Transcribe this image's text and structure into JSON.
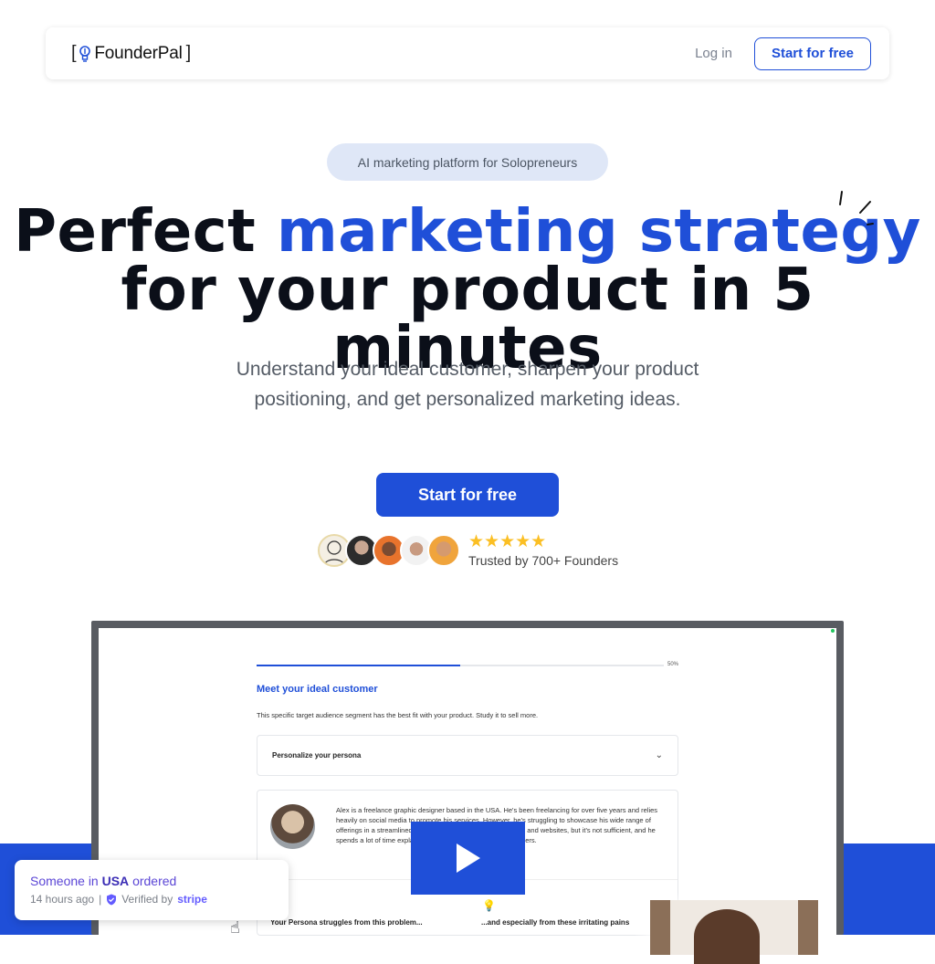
{
  "header": {
    "logo_text": "FounderPal",
    "logo_bracket_left": "[",
    "logo_bracket_right": "]",
    "login_label": "Log in",
    "start_label": "Start for free"
  },
  "hero": {
    "badge": "AI marketing platform for Solopreneurs",
    "title_part1": "Perfect ",
    "title_accent": "marketing strategy",
    "title_line2": "for your product in 5 minutes",
    "subtitle_line1": "Understand your ideal customer, sharpen your product",
    "subtitle_line2": "positioning, and get personalized marketing ideas.",
    "cta_label": "Start for free",
    "stars": "★★★★★",
    "trusted": "Trusted by 700+ Founders"
  },
  "demo": {
    "progress_percent": 50,
    "progress_label": "50%",
    "heading": "Meet your ideal customer",
    "subheading": "This specific target audience segment has the best fit with your product. Study it to sell more.",
    "persona_label": "Personalize your persona",
    "description": "Alex is a freelance graphic designer based in the USA. He's been freelancing for over five years and relies heavily on social media to promote his services. However, he's struggling to showcase his wide range of offerings in a streamlined way. Currently, he uses various tools and websites, but it's not sufficient, and he spends a lot of time explaining his services to potential customers.",
    "struggles_label": "Your Persona struggles from this problem...",
    "irritating_label": "...and especially from these irritating pains"
  },
  "toast": {
    "prefix": "Someone in",
    "country": "USA",
    "suffix": "ordered",
    "time": "14 hours ago",
    "separator": "|",
    "verified": "Verified by",
    "brand": "stripe"
  },
  "colors": {
    "accent": "#1f4fd8",
    "star": "#fbbf24",
    "stripe": "#635bff"
  },
  "icons": [
    "lightbulb-icon",
    "play-icon",
    "chevron-down-icon",
    "shield-check-icon",
    "hand-cursor-icon",
    "sparkle-icon"
  ]
}
